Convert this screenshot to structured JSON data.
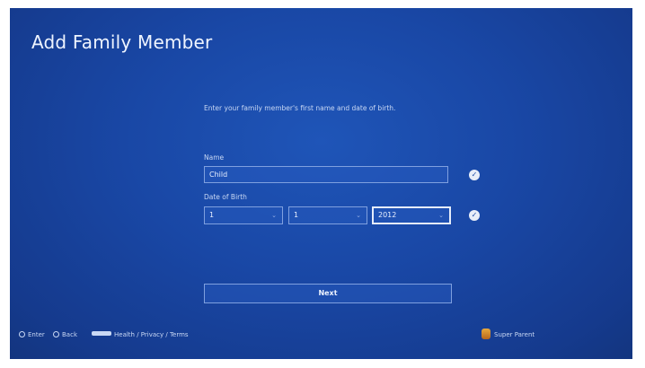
{
  "screen": {
    "title": "Add Family Member"
  },
  "form": {
    "intro": "Enter your family member's first name and date of birth.",
    "name_label": "Name",
    "name_value": "Child",
    "dob_label": "Date of Birth",
    "dob_day": "1",
    "dob_month": "1",
    "dob_year": "2012",
    "next_label": "Next"
  },
  "footer": {
    "enter_label": "Enter",
    "back_label": "Back",
    "links_label": "Health / Privacy / Terms",
    "user_name": "Super Parent"
  },
  "icons": {
    "check": "check-circle-icon",
    "dropdown": "chevron-down-icon",
    "cross_button": "cross-button-icon",
    "circle_button": "circle-button-icon",
    "options_button": "options-button-icon"
  },
  "colors": {
    "background": "#1947a5",
    "text": "#eef4ff"
  }
}
